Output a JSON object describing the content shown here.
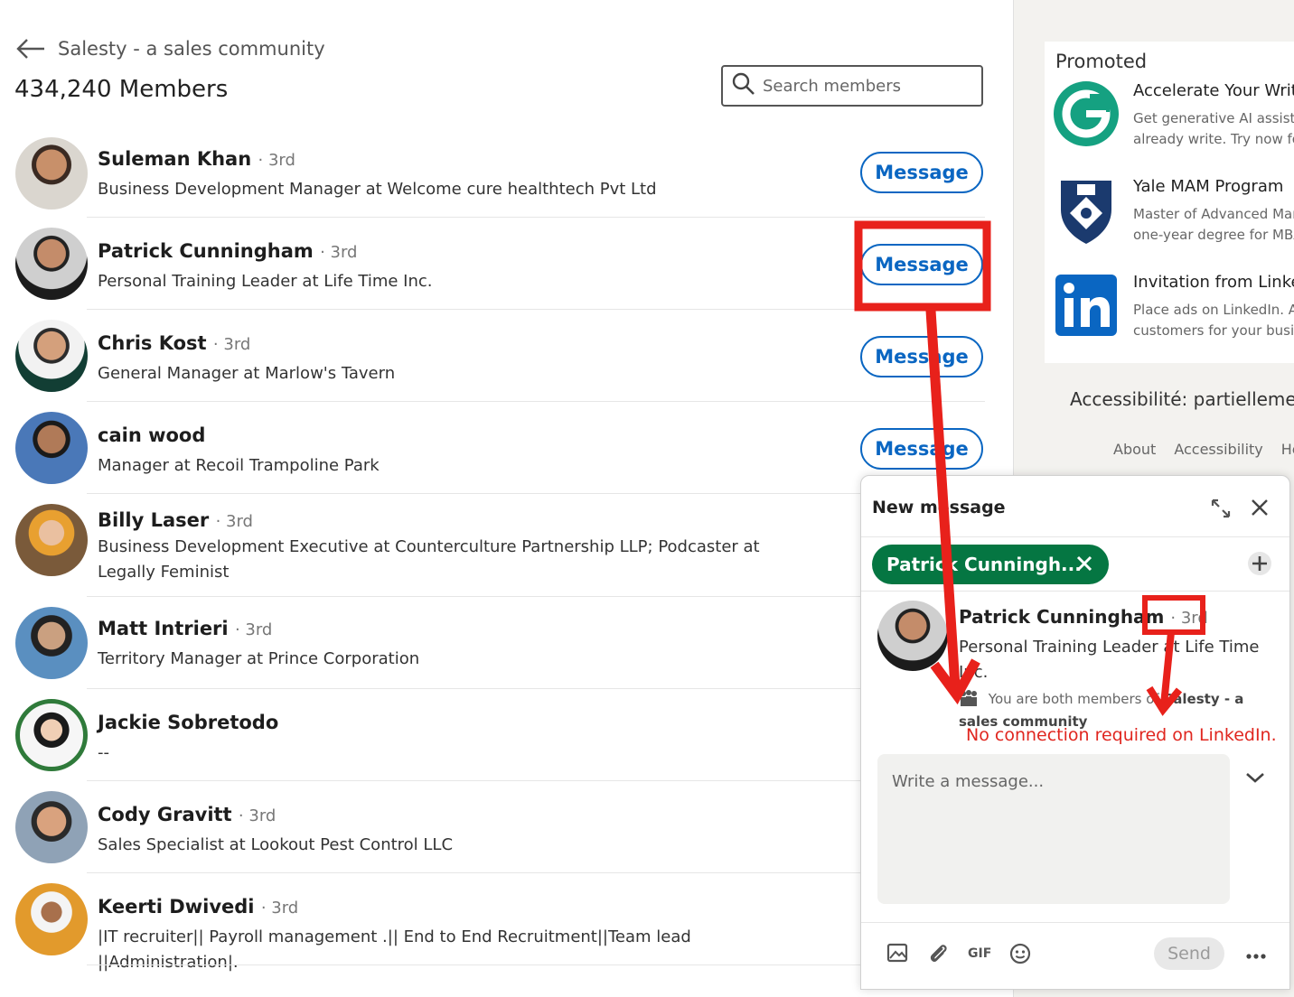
{
  "header": {
    "group_name": "Salesty - a sales community",
    "member_count": "434,240 Members",
    "search_placeholder": "Search members"
  },
  "members": [
    {
      "name": "Suleman Khan",
      "degree": "· 3rd",
      "headline": "Business Development Manager at Welcome cure healthtech Pvt Ltd",
      "button": "Message"
    },
    {
      "name": "Patrick Cunningham",
      "degree": "· 3rd",
      "headline": "Personal Training Leader at Life Time Inc.",
      "button": "Message"
    },
    {
      "name": "Chris Kost",
      "degree": "· 3rd",
      "headline": "General Manager at Marlow's Tavern",
      "button": "Message"
    },
    {
      "name": "cain wood",
      "degree": "",
      "headline": "Manager at Recoil Trampoline Park",
      "button": "Message"
    },
    {
      "name": "Billy Laser",
      "degree": "· 3rd",
      "headline": "Business Development Executive at Counterculture Partnership LLP; Podcaster at Legally Feminist"
    },
    {
      "name": "Matt Intrieri",
      "degree": "· 3rd",
      "headline": "Territory Manager at Prince Corporation"
    },
    {
      "name": "Jackie Sobretodo",
      "degree": "",
      "headline": "--"
    },
    {
      "name": "Cody Gravitt",
      "degree": "· 3rd",
      "headline": "Sales Specialist at Lookout Pest Control LLC"
    },
    {
      "name": "Keerti Dwivedi",
      "degree": "· 3rd",
      "headline": "|IT recruiter|| Payroll management .|| End to End Recruitment||Team lead ||Administration|."
    }
  ],
  "sidebar": {
    "promoted_label": "Promoted",
    "ads": [
      {
        "title": "Accelerate Your Writing",
        "desc1": "Get generative AI assistance",
        "desc2": "already write. Try now for free",
        "icon": "grammarly-logo"
      },
      {
        "title": "Yale MAM Program",
        "desc1": "Master of Advanced Management",
        "desc2": "one-year degree for MBAs",
        "icon": "yale-shield-logo"
      },
      {
        "title": "Invitation from LinkedIn",
        "desc1": "Place ads on LinkedIn. Attract",
        "desc2": "customers for your business",
        "icon": "linkedin-logo"
      }
    ],
    "accessibility": "Accessibilité: partiellement",
    "footer_links": [
      "About",
      "Accessibility",
      "Help"
    ]
  },
  "compose": {
    "title": "New message",
    "recipient_pill": "Patrick Cunningh...",
    "profile_name": "Patrick Cunningham",
    "profile_degree": "· 3rd",
    "profile_headline": "Personal Training Leader at Life Time Inc.",
    "shared_prefix": "You are both members of",
    "shared_group": "Salesty - a sales community",
    "annotation_note": "No connection required on LinkedIn.",
    "message_placeholder": "Write a message...",
    "send_label": "Send",
    "gif_label": "GIF"
  },
  "colors": {
    "accent": "#0a66c2",
    "pill_green": "#057642",
    "annotation_red": "#e0261f"
  }
}
